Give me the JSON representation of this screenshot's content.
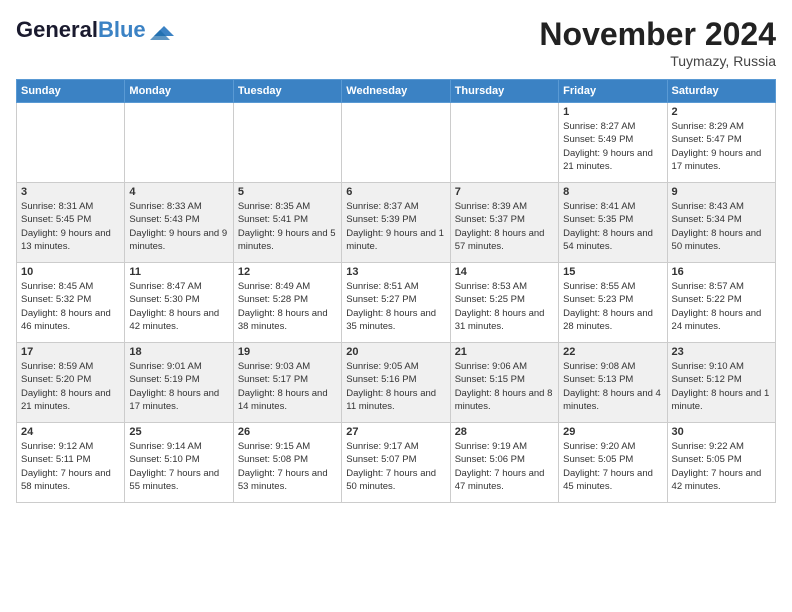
{
  "header": {
    "logo_line1": "General",
    "logo_line2": "Blue",
    "month": "November 2024",
    "location": "Tuymazy, Russia"
  },
  "weekdays": [
    "Sunday",
    "Monday",
    "Tuesday",
    "Wednesday",
    "Thursday",
    "Friday",
    "Saturday"
  ],
  "weeks": [
    [
      {
        "day": "",
        "info": ""
      },
      {
        "day": "",
        "info": ""
      },
      {
        "day": "",
        "info": ""
      },
      {
        "day": "",
        "info": ""
      },
      {
        "day": "",
        "info": ""
      },
      {
        "day": "1",
        "info": "Sunrise: 8:27 AM\nSunset: 5:49 PM\nDaylight: 9 hours and 21 minutes."
      },
      {
        "day": "2",
        "info": "Sunrise: 8:29 AM\nSunset: 5:47 PM\nDaylight: 9 hours and 17 minutes."
      }
    ],
    [
      {
        "day": "3",
        "info": "Sunrise: 8:31 AM\nSunset: 5:45 PM\nDaylight: 9 hours and 13 minutes."
      },
      {
        "day": "4",
        "info": "Sunrise: 8:33 AM\nSunset: 5:43 PM\nDaylight: 9 hours and 9 minutes."
      },
      {
        "day": "5",
        "info": "Sunrise: 8:35 AM\nSunset: 5:41 PM\nDaylight: 9 hours and 5 minutes."
      },
      {
        "day": "6",
        "info": "Sunrise: 8:37 AM\nSunset: 5:39 PM\nDaylight: 9 hours and 1 minute."
      },
      {
        "day": "7",
        "info": "Sunrise: 8:39 AM\nSunset: 5:37 PM\nDaylight: 8 hours and 57 minutes."
      },
      {
        "day": "8",
        "info": "Sunrise: 8:41 AM\nSunset: 5:35 PM\nDaylight: 8 hours and 54 minutes."
      },
      {
        "day": "9",
        "info": "Sunrise: 8:43 AM\nSunset: 5:34 PM\nDaylight: 8 hours and 50 minutes."
      }
    ],
    [
      {
        "day": "10",
        "info": "Sunrise: 8:45 AM\nSunset: 5:32 PM\nDaylight: 8 hours and 46 minutes."
      },
      {
        "day": "11",
        "info": "Sunrise: 8:47 AM\nSunset: 5:30 PM\nDaylight: 8 hours and 42 minutes."
      },
      {
        "day": "12",
        "info": "Sunrise: 8:49 AM\nSunset: 5:28 PM\nDaylight: 8 hours and 38 minutes."
      },
      {
        "day": "13",
        "info": "Sunrise: 8:51 AM\nSunset: 5:27 PM\nDaylight: 8 hours and 35 minutes."
      },
      {
        "day": "14",
        "info": "Sunrise: 8:53 AM\nSunset: 5:25 PM\nDaylight: 8 hours and 31 minutes."
      },
      {
        "day": "15",
        "info": "Sunrise: 8:55 AM\nSunset: 5:23 PM\nDaylight: 8 hours and 28 minutes."
      },
      {
        "day": "16",
        "info": "Sunrise: 8:57 AM\nSunset: 5:22 PM\nDaylight: 8 hours and 24 minutes."
      }
    ],
    [
      {
        "day": "17",
        "info": "Sunrise: 8:59 AM\nSunset: 5:20 PM\nDaylight: 8 hours and 21 minutes."
      },
      {
        "day": "18",
        "info": "Sunrise: 9:01 AM\nSunset: 5:19 PM\nDaylight: 8 hours and 17 minutes."
      },
      {
        "day": "19",
        "info": "Sunrise: 9:03 AM\nSunset: 5:17 PM\nDaylight: 8 hours and 14 minutes."
      },
      {
        "day": "20",
        "info": "Sunrise: 9:05 AM\nSunset: 5:16 PM\nDaylight: 8 hours and 11 minutes."
      },
      {
        "day": "21",
        "info": "Sunrise: 9:06 AM\nSunset: 5:15 PM\nDaylight: 8 hours and 8 minutes."
      },
      {
        "day": "22",
        "info": "Sunrise: 9:08 AM\nSunset: 5:13 PM\nDaylight: 8 hours and 4 minutes."
      },
      {
        "day": "23",
        "info": "Sunrise: 9:10 AM\nSunset: 5:12 PM\nDaylight: 8 hours and 1 minute."
      }
    ],
    [
      {
        "day": "24",
        "info": "Sunrise: 9:12 AM\nSunset: 5:11 PM\nDaylight: 7 hours and 58 minutes."
      },
      {
        "day": "25",
        "info": "Sunrise: 9:14 AM\nSunset: 5:10 PM\nDaylight: 7 hours and 55 minutes."
      },
      {
        "day": "26",
        "info": "Sunrise: 9:15 AM\nSunset: 5:08 PM\nDaylight: 7 hours and 53 minutes."
      },
      {
        "day": "27",
        "info": "Sunrise: 9:17 AM\nSunset: 5:07 PM\nDaylight: 7 hours and 50 minutes."
      },
      {
        "day": "28",
        "info": "Sunrise: 9:19 AM\nSunset: 5:06 PM\nDaylight: 7 hours and 47 minutes."
      },
      {
        "day": "29",
        "info": "Sunrise: 9:20 AM\nSunset: 5:05 PM\nDaylight: 7 hours and 45 minutes."
      },
      {
        "day": "30",
        "info": "Sunrise: 9:22 AM\nSunset: 5:05 PM\nDaylight: 7 hours and 42 minutes."
      }
    ]
  ]
}
